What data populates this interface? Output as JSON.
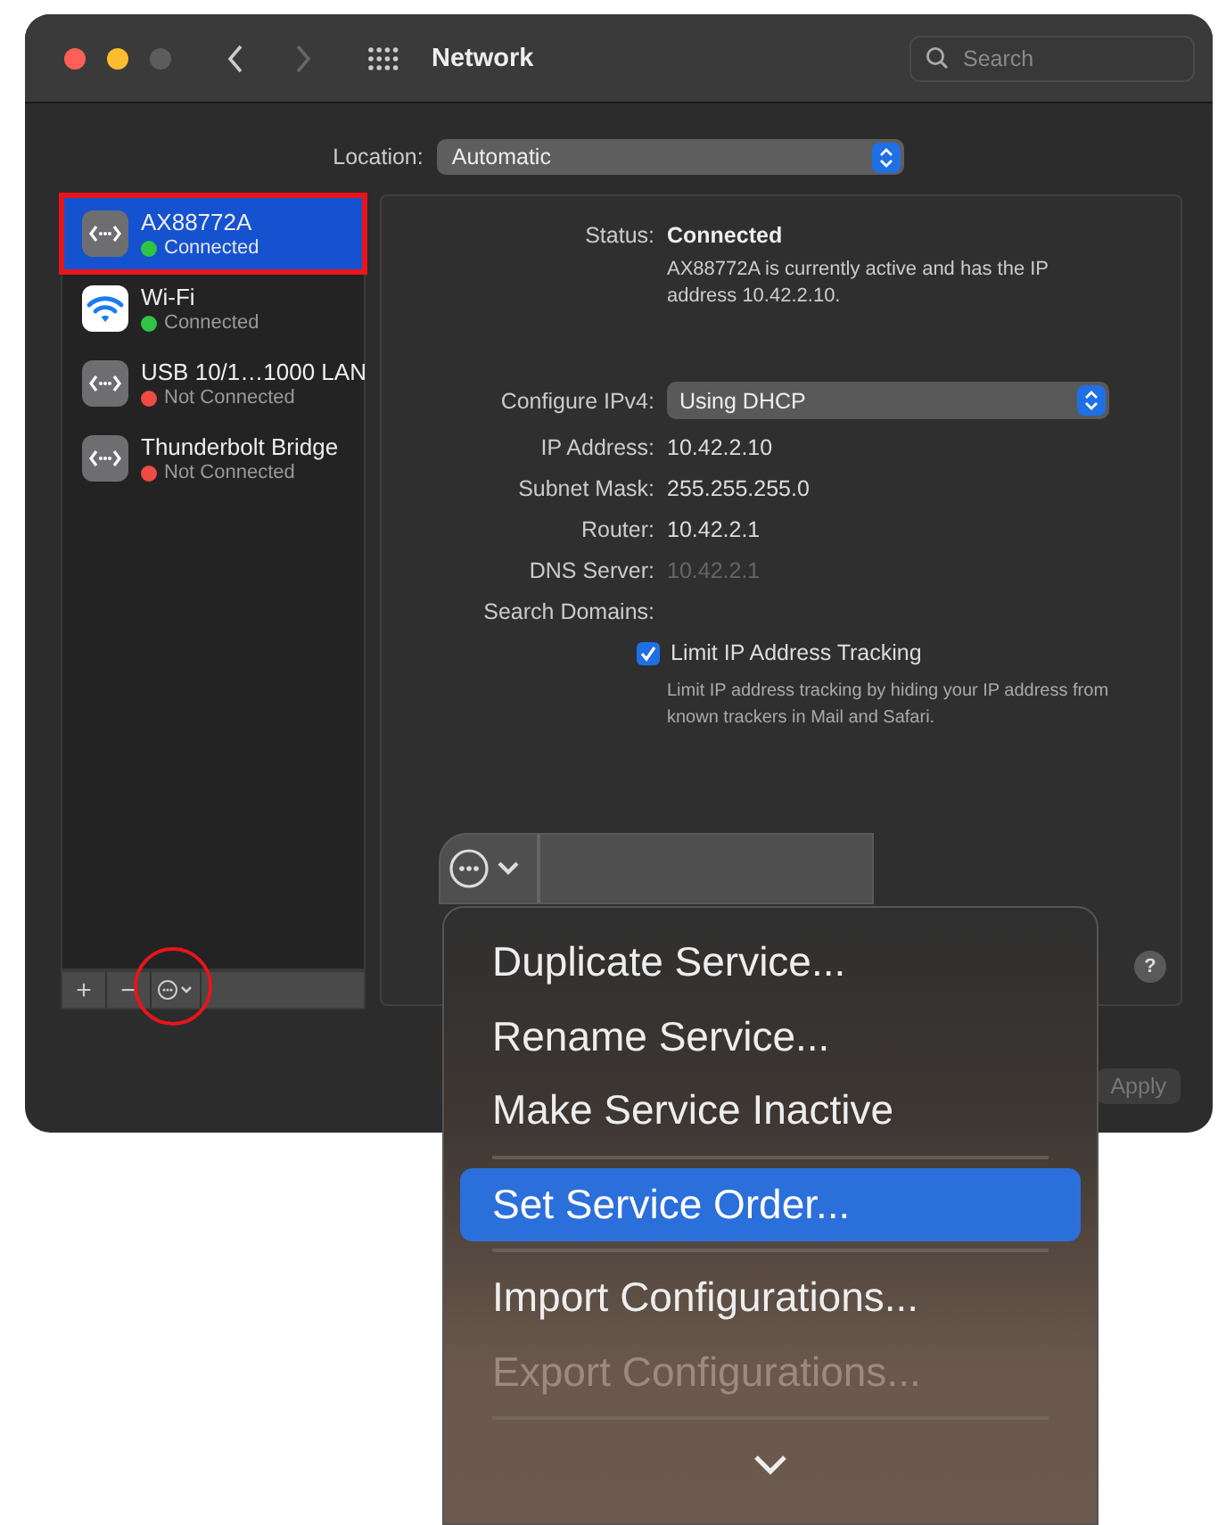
{
  "window": {
    "title": "Network"
  },
  "toolbar": {
    "search": {
      "placeholder": "Search"
    }
  },
  "location": {
    "label": "Location:",
    "value": "Automatic"
  },
  "services": [
    {
      "name": "AX88772A",
      "status": "Connected",
      "color": "#30c444",
      "kind": "ethernet",
      "selected": true,
      "highlighted": true
    },
    {
      "name": "Wi-Fi",
      "status": "Connected",
      "color": "#30c444",
      "kind": "wifi",
      "selected": false,
      "highlighted": false
    },
    {
      "name": "USB 10/1…1000 LAN",
      "status": "Not Connected",
      "color": "#f04a44",
      "kind": "ethernet",
      "selected": false,
      "highlighted": false
    },
    {
      "name": "Thunderbolt Bridge",
      "status": "Not Connected",
      "color": "#f04a44",
      "kind": "ethernet",
      "selected": false,
      "highlighted": false
    }
  ],
  "service_buttons": [
    {
      "kind": "text",
      "label": "+"
    },
    {
      "kind": "text",
      "label": "−"
    },
    {
      "kind": "action",
      "highlighted": true
    }
  ],
  "details": {
    "status_label": "Status:",
    "status": "Connected",
    "status_note": "AX88772A is currently active and has the IP address 10.42.2.10.",
    "configure": {
      "label": "Configure IPv4:",
      "value": "Using DHCP"
    },
    "fields": [
      {
        "label": "IP Address:",
        "value": "10.42.2.10",
        "disabled": false
      },
      {
        "label": "Subnet Mask:",
        "value": "255.255.255.0",
        "disabled": false
      },
      {
        "label": "Router:",
        "value": "10.42.2.1",
        "disabled": false
      },
      {
        "label": "DNS Server:",
        "value": "10.42.2.1",
        "disabled": true
      },
      {
        "label": "Search Domains:"
      }
    ],
    "limit_tracking": {
      "label": "Limit IP Address Tracking",
      "checked": true,
      "note": "Limit IP address tracking by hiding your IP address from known trackers in Mail and Safari."
    }
  },
  "help": {
    "label": "?"
  },
  "apply": {
    "label": "Apply",
    "disabled": true
  },
  "menu": [
    {
      "kind": "item",
      "label": "Duplicate Service...",
      "selected": false,
      "disabled": false
    },
    {
      "kind": "item",
      "label": "Rename Service...",
      "selected": false,
      "disabled": false
    },
    {
      "kind": "item",
      "label": "Make Service Inactive",
      "selected": false,
      "disabled": false
    },
    {
      "kind": "separator"
    },
    {
      "kind": "item",
      "label": "Set Service Order...",
      "selected": true,
      "disabled": false
    },
    {
      "kind": "separator"
    },
    {
      "kind": "item",
      "label": "Import Configurations...",
      "selected": false,
      "disabled": false
    },
    {
      "kind": "item",
      "label": "Export Configurations...",
      "selected": false,
      "disabled": true
    },
    {
      "kind": "separator"
    },
    {
      "kind": "more"
    }
  ]
}
